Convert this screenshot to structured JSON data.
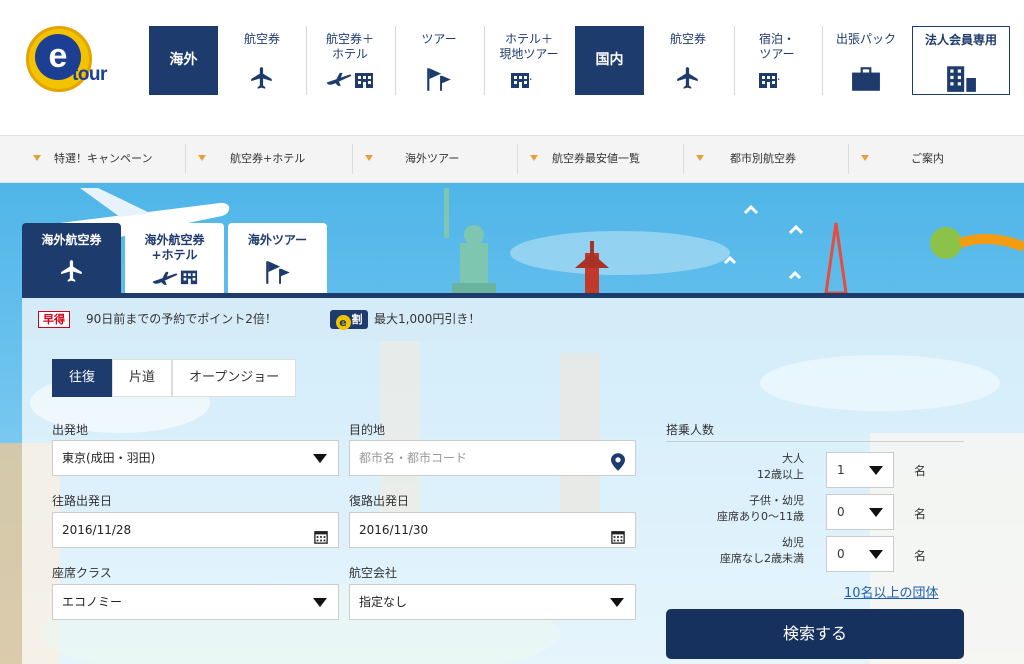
{
  "logo": {
    "letter": "e",
    "text": "tour"
  },
  "header": {
    "nav": [
      {
        "id": "overseas",
        "label": "海外",
        "type": "section",
        "icon": ""
      },
      {
        "id": "air",
        "label": "航空券",
        "type": "link",
        "icon": "plane-icon"
      },
      {
        "id": "air-hotel",
        "label": "航空券＋\nホテル",
        "type": "link",
        "icon": "plane-hotel-icon"
      },
      {
        "id": "tour",
        "label": "ツアー",
        "type": "link",
        "icon": "flag-icon"
      },
      {
        "id": "hotel-localtour",
        "label": "ホテル＋\n現地ツアー",
        "type": "link",
        "icon": "hotel-flag-icon"
      },
      {
        "id": "domestic",
        "label": "国内",
        "type": "section",
        "icon": ""
      },
      {
        "id": "dom-air",
        "label": "航空券",
        "type": "link",
        "icon": "plane-icon"
      },
      {
        "id": "dom-stay-tour",
        "label": "宿泊・\nツアー",
        "type": "link",
        "icon": "hotel-flag-icon"
      },
      {
        "id": "business",
        "label": "出張パック",
        "type": "link",
        "icon": "briefcase-icon"
      },
      {
        "id": "corporate",
        "label": "法人会員専用",
        "type": "link",
        "icon": "building-icon"
      }
    ]
  },
  "subnav": {
    "items": [
      {
        "label": "特選！キャンペーン"
      },
      {
        "label": "航空券+ホテル"
      },
      {
        "label": "海外ツアー"
      },
      {
        "label": "航空券最安値一覧"
      },
      {
        "label": "都市別航空券"
      },
      {
        "label": "ご案内"
      }
    ]
  },
  "tabs": [
    {
      "label": "海外航空券",
      "icon": "plane-icon",
      "active": true
    },
    {
      "label": "海外航空券\n+ホテル",
      "icon": "plane-hotel-icon",
      "active": false
    },
    {
      "label": "海外ツアー",
      "icon": "flag-icon",
      "active": false
    }
  ],
  "promo": {
    "badge1": "早得",
    "text1": "90日前までの予約でポイント2倍！",
    "badge2_letter": "e",
    "badge2_text": "割",
    "text2": "最大1,000円引き！"
  },
  "trip_type": {
    "options": [
      "往復",
      "片道",
      "オープンジョー"
    ],
    "selected": "往復"
  },
  "form": {
    "origin_label": "出発地",
    "origin_value": "東京(成田・羽田)",
    "destination_label": "目的地",
    "destination_placeholder": "都市名・都市コード",
    "depart_label": "往路出発日",
    "depart_value": "2016/11/28",
    "return_label": "復路出発日",
    "return_value": "2016/11/30",
    "class_label": "座席クラス",
    "class_value": "エコノミー",
    "airline_label": "航空会社",
    "airline_value": "指定なし"
  },
  "passengers": {
    "title": "搭乗人数",
    "adult_line1": "大人",
    "adult_line2": "12歳以上",
    "adult_value": "1",
    "child_line1": "子供・幼児",
    "child_line2": "座席あり0〜11歳",
    "child_value": "0",
    "infant_line1": "幼児",
    "infant_line2": "座席なし2歳未満",
    "infant_value": "0",
    "unit": "名",
    "group_link": "10名以上の団体"
  },
  "search_button": "検索する",
  "colors": {
    "navy": "#1e3b6e",
    "accent": "#f3c300",
    "link": "#1c5fb4",
    "promo_red": "#d0021b"
  }
}
